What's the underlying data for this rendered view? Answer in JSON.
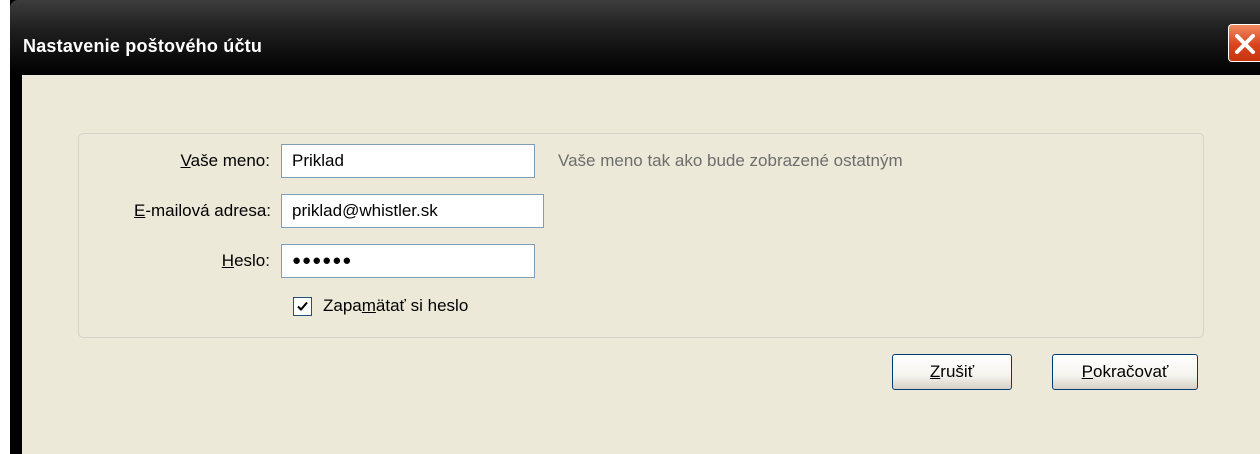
{
  "window": {
    "title": "Nastavenie poštového účtu"
  },
  "form": {
    "name": {
      "label_prefix": "",
      "label_accel": "V",
      "label_rest": "aše meno:",
      "value": "Priklad",
      "hint": "Vaše meno tak ako bude zobrazené ostatným"
    },
    "email": {
      "label_prefix": "",
      "label_accel": "E",
      "label_rest": "-mailová adresa:",
      "value": "priklad@whistler.sk"
    },
    "password": {
      "label_prefix": "",
      "label_accel": "H",
      "label_rest": "eslo:",
      "masked_value": "●●●●●●"
    },
    "remember": {
      "checked": true,
      "label_prefix": "Zapa",
      "label_accel": "m",
      "label_rest": "ätať si heslo"
    }
  },
  "buttons": {
    "cancel": {
      "accel": "Z",
      "rest": "rušiť"
    },
    "continue": {
      "accel": "P",
      "rest": "okračovať"
    }
  },
  "icons": {
    "close": "close-icon",
    "check": "checkmark-icon"
  },
  "colors": {
    "titlebar": "#000000",
    "client_bg": "#ece9d8",
    "close_red": "#d9441c",
    "hint_gray": "#6d6d6d"
  }
}
